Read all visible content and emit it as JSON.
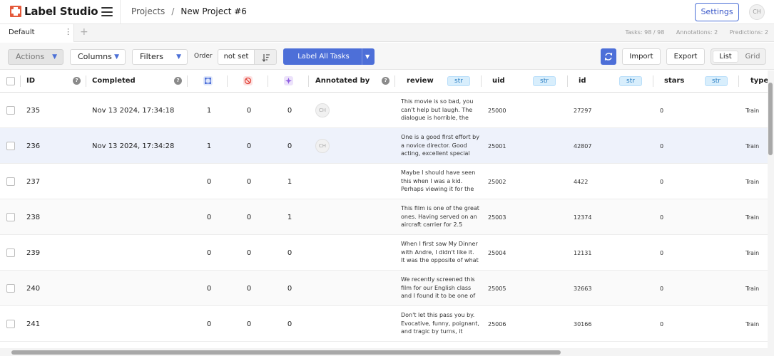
{
  "app": {
    "name": "Label Studio",
    "brand_color": "#e4593a",
    "accent_color": "#4d6fd8"
  },
  "header": {
    "breadcrumb": [
      "Projects",
      "New Project #6"
    ],
    "settings_label": "Settings",
    "user_initials": "CH"
  },
  "tabs": {
    "items": [
      {
        "label": "Default"
      }
    ],
    "add_icon": "plus-icon"
  },
  "stats": {
    "tasks": "Tasks: 98 / 98",
    "annotations": "Annotations: 2",
    "predictions": "Predictions: 2"
  },
  "toolbar": {
    "actions_label": "Actions",
    "columns_label": "Columns",
    "filters_label": "Filters",
    "order_label": "Order",
    "order_value": "not set",
    "label_all_label": "Label All Tasks",
    "import_label": "Import",
    "export_label": "Export",
    "view_list_label": "List",
    "view_grid_label": "Grid",
    "view_selected": "List"
  },
  "columns": {
    "id": "ID",
    "completed": "Completed",
    "total_annotations_icon": "total-annotations-icon",
    "cancelled_icon": "cancelled-annotations-icon",
    "predictions_icon": "predictions-icon",
    "annotated_by": "Annotated by",
    "review": "review",
    "uid": "uid",
    "id2": "id",
    "stars": "stars",
    "type": "type",
    "str_tag": "str"
  },
  "rows": [
    {
      "id": "235",
      "completed": "Nov 13 2024, 17:34:18",
      "total": "1",
      "cancelled": "0",
      "predictions": "0",
      "annotator": "CH",
      "review": "This movie is so bad, you can't help but laugh. The dialogue is horrible, the",
      "uid": "25000",
      "id2": "27297",
      "stars": "0",
      "type": "Train"
    },
    {
      "id": "236",
      "completed": "Nov 13 2024, 17:34:28",
      "total": "1",
      "cancelled": "0",
      "predictions": "0",
      "annotator": "CH",
      "review": "One is a good first effort by a novice director. Good acting, excellent special",
      "uid": "25001",
      "id2": "42807",
      "stars": "0",
      "type": "Train"
    },
    {
      "id": "237",
      "completed": "",
      "total": "0",
      "cancelled": "0",
      "predictions": "1",
      "annotator": "",
      "review": "Maybe I should have seen this when I was a kid. Perhaps viewing it for the",
      "uid": "25002",
      "id2": "4422",
      "stars": "0",
      "type": "Train"
    },
    {
      "id": "238",
      "completed": "",
      "total": "0",
      "cancelled": "0",
      "predictions": "1",
      "annotator": "",
      "review": "This film is one of the great ones. Having served on an aircraft carrier for 2.5 years,",
      "uid": "25003",
      "id2": "12374",
      "stars": "0",
      "type": "Train"
    },
    {
      "id": "239",
      "completed": "",
      "total": "0",
      "cancelled": "0",
      "predictions": "0",
      "annotator": "",
      "review": "When I first saw My Dinner with Andre, I didn't like it. It was the opposite of what I",
      "uid": "25004",
      "id2": "12131",
      "stars": "0",
      "type": "Train"
    },
    {
      "id": "240",
      "completed": "",
      "total": "0",
      "cancelled": "0",
      "predictions": "0",
      "annotator": "",
      "review": "We recently screened this film for our English class and I found it to be one of",
      "uid": "25005",
      "id2": "32663",
      "stars": "0",
      "type": "Train"
    },
    {
      "id": "241",
      "completed": "",
      "total": "0",
      "cancelled": "0",
      "predictions": "0",
      "annotator": "",
      "review": "Don't let this pass you by. Evocative, funny, poignant, and tragic by turns, it",
      "uid": "25006",
      "id2": "30166",
      "stars": "0",
      "type": "Train"
    }
  ]
}
